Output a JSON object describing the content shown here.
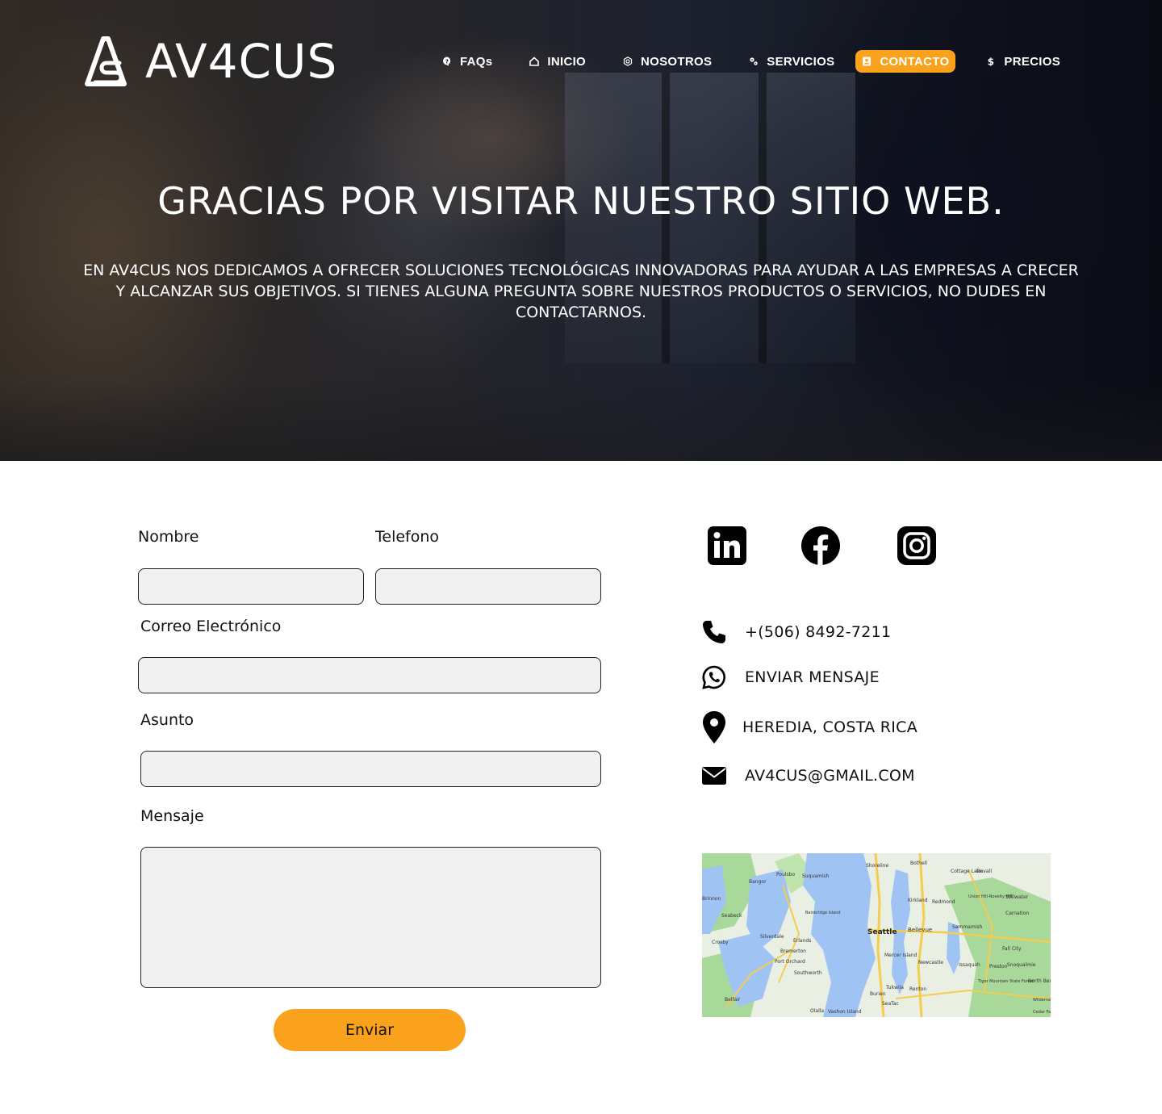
{
  "header": {
    "logo_text": "AV4CUS",
    "nav": [
      {
        "label": "FAQs",
        "icon": "question-bubble-icon"
      },
      {
        "label": "INICIO",
        "icon": "home-icon"
      },
      {
        "label": "NOSOTROS",
        "icon": "hexagon-gear-icon"
      },
      {
        "label": "SERVICIOS",
        "icon": "gears-icon"
      },
      {
        "label": "CONTACTO",
        "icon": "contact-card-icon",
        "active": true
      },
      {
        "label": "PRECIOS",
        "icon": "dollar-icon"
      }
    ]
  },
  "hero": {
    "title": "GRACIAS POR VISITAR NUESTRO SITIO WEB.",
    "text": "EN AV4CUS NOS DEDICAMOS A OFRECER SOLUCIONES TECNOLÓGICAS INNOVADORAS PARA AYUDAR A LAS EMPRESAS A CRECER Y ALCANZAR SUS OBJETIVOS. SI TIENES ALGUNA PREGUNTA SOBRE NUESTROS PRODUCTOS O SERVICIOS, NO DUDES EN CONTACTARNOS."
  },
  "form": {
    "nombre_label": "Nombre",
    "telefono_label": "Telefono",
    "correo_label": "Correo Electrónico",
    "asunto_label": "Asunto",
    "mensaje_label": "Mensaje",
    "nombre_value": "",
    "telefono_value": "",
    "correo_value": "",
    "asunto_value": "",
    "mensaje_value": "",
    "submit_label": "Enviar"
  },
  "contact": {
    "social": [
      "linkedin-icon",
      "facebook-icon",
      "instagram-icon"
    ],
    "phone": "+(506) 8492-7211",
    "whatsapp": "ENVIAR MENSAJE",
    "location": "HEREDIA, COSTA RICA",
    "email": "AV4CUS@GMAIL.COM"
  },
  "map": {
    "labels": [
      "Seattle",
      "Bellevue",
      "Kirkland",
      "Redmond",
      "Shoreline",
      "Bothell",
      "Poulsbo",
      "Bangor",
      "Bremerton",
      "Port Orchard",
      "Renton",
      "Burien",
      "Newcastle",
      "Issaquah",
      "Sammamish",
      "Seabeck",
      "Silverdale",
      "Brinnon",
      "Crosby",
      "Southworth",
      "Belfair",
      "Olalla",
      "Vashon Island",
      "Tukwila",
      "SeaTac",
      "Preston",
      "Snoqualmie",
      "Fall City",
      "Carnation",
      "Duvall",
      "Stillwater",
      "Cottage Lake",
      "Union Hill-Novelty Hill",
      "Mercer Island",
      "Bainbridge Island",
      "Erlands",
      "Suquamish",
      "Tiger Mountain State Forest",
      "North Bend",
      "Wilderness",
      "Cedar Fa"
    ],
    "colors": {
      "water": "#9fc4f4",
      "land": "#e9efe3",
      "park": "#a8d89a",
      "road": "#f5cc4e"
    }
  },
  "colors": {
    "accent": "#fba21c",
    "field_bg": "#f1f1f1"
  }
}
